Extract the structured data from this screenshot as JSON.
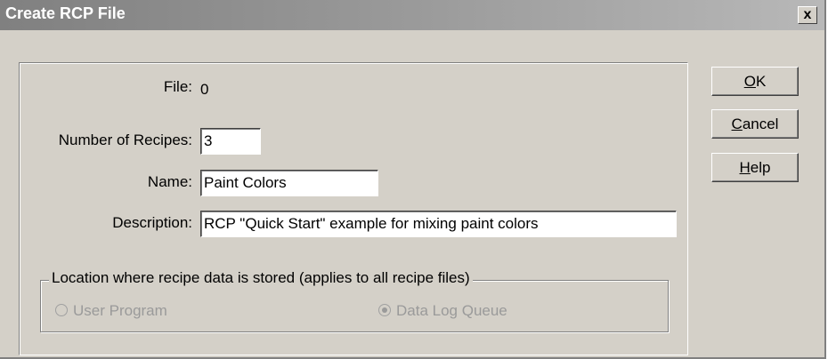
{
  "window": {
    "title": "Create RCP File",
    "close_label": "x"
  },
  "form": {
    "file_label": "File:",
    "file_value": "0",
    "num_recipes_label": "Number of Recipes:",
    "num_recipes_value": "3",
    "name_label": "Name:",
    "name_value": "Paint Colors",
    "description_label": "Description:",
    "description_value": "RCP \"Quick Start\" example for mixing paint colors"
  },
  "location": {
    "legend": "Location where recipe data is stored  (applies to all recipe files)",
    "options": [
      {
        "label": "User Program",
        "selected": false,
        "enabled": false
      },
      {
        "label": "Data Log Queue",
        "selected": true,
        "enabled": false
      }
    ]
  },
  "buttons": {
    "ok_accel": "O",
    "ok_rest": "K",
    "cancel_accel": "C",
    "cancel_rest": "ancel",
    "help_accel": "H",
    "help_rest": "elp"
  },
  "colors": {
    "dialog_bg": "#d4d0c8",
    "title_start": "#808080",
    "title_end": "#b8b8b8",
    "disabled_text": "#9a9a9a"
  }
}
